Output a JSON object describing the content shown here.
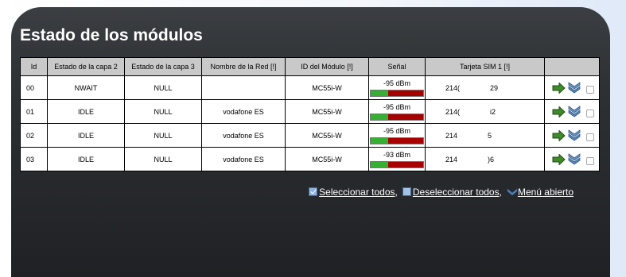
{
  "page": {
    "title": "Estado de los módulos"
  },
  "table": {
    "headers": [
      "Id",
      "Estado de la capa 2",
      "Estado de la capa 3",
      "Nombre de la Red [!]",
      "ID del Módulo [!]",
      "Señal",
      "Tarjeta SIM 1 [!]",
      ""
    ],
    "rows": [
      {
        "id": "00",
        "layer2": "NWAIT",
        "layer3": "NULL",
        "network": "",
        "module": "MC55i-W",
        "signal": "-95 dBm",
        "signal_level": 0.33,
        "sim_start": "214(",
        "sim_end": "29"
      },
      {
        "id": "01",
        "layer2": "IDLE",
        "layer3": "NULL",
        "network": "vodafone ES",
        "module": "MC55i-W",
        "signal": "-95 dBm",
        "signal_level": 0.33,
        "sim_start": "214(",
        "sim_end": "i2"
      },
      {
        "id": "02",
        "layer2": "IDLE",
        "layer3": "NULL",
        "network": "vodafone ES",
        "module": "MC55i-W",
        "signal": "-95 dBm",
        "signal_level": 0.33,
        "sim_start": "214",
        "sim_end": "5"
      },
      {
        "id": "03",
        "layer2": "IDLE",
        "layer3": "NULL",
        "network": "vodafone ES",
        "module": "MC55i-W",
        "signal": "-93 dBm",
        "signal_level": 0.33,
        "sim_start": "214",
        "sim_end": ")6"
      }
    ]
  },
  "links": {
    "select_all": "Seleccionar todos",
    "deselect_all": "Deseleccionar todos",
    "open_menu": "Menú abierto",
    "separator": ","
  },
  "icons": {
    "go": "green-arrow-right-icon",
    "menu": "double-chevron-down-icon",
    "select_all": "checked-box-icon",
    "deselect_all": "empty-box-icon",
    "open_menu": "chevron-down-icon"
  },
  "colors": {
    "signal_good": "#35b032",
    "signal_bad": "#a80000",
    "header_bg": "#c9c9c9",
    "panel_bg": "#2e3134",
    "arrow_green": "#3f8a2a",
    "chevron_blue": "#5b86b8"
  }
}
